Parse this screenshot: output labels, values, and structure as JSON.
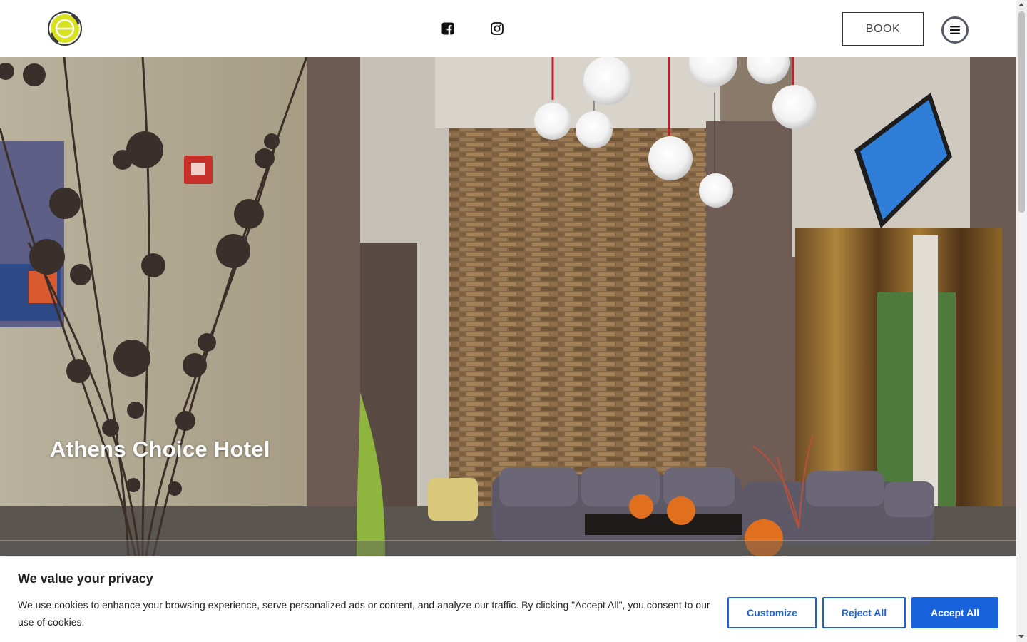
{
  "header": {
    "logo_alt": "hotel-logo",
    "social": {
      "facebook": "facebook-icon",
      "instagram": "instagram-icon"
    },
    "book_label": "BOOK",
    "menu_icon": "hamburger-menu-icon"
  },
  "hero": {
    "title": "Athens Choice Hotel"
  },
  "cookie_banner": {
    "title": "We value your privacy",
    "text": "We use cookies to enhance your browsing experience, serve personalized ads or content, and analyze our traffic. By clicking \"Accept All\", you consent to our use of cookies.",
    "customize_label": "Customize",
    "reject_label": "Reject All",
    "accept_label": "Accept All"
  },
  "colors": {
    "accent_blue": "#1863dc",
    "logo_yellow": "#d9e21f",
    "header_bg": "#ffffff"
  }
}
